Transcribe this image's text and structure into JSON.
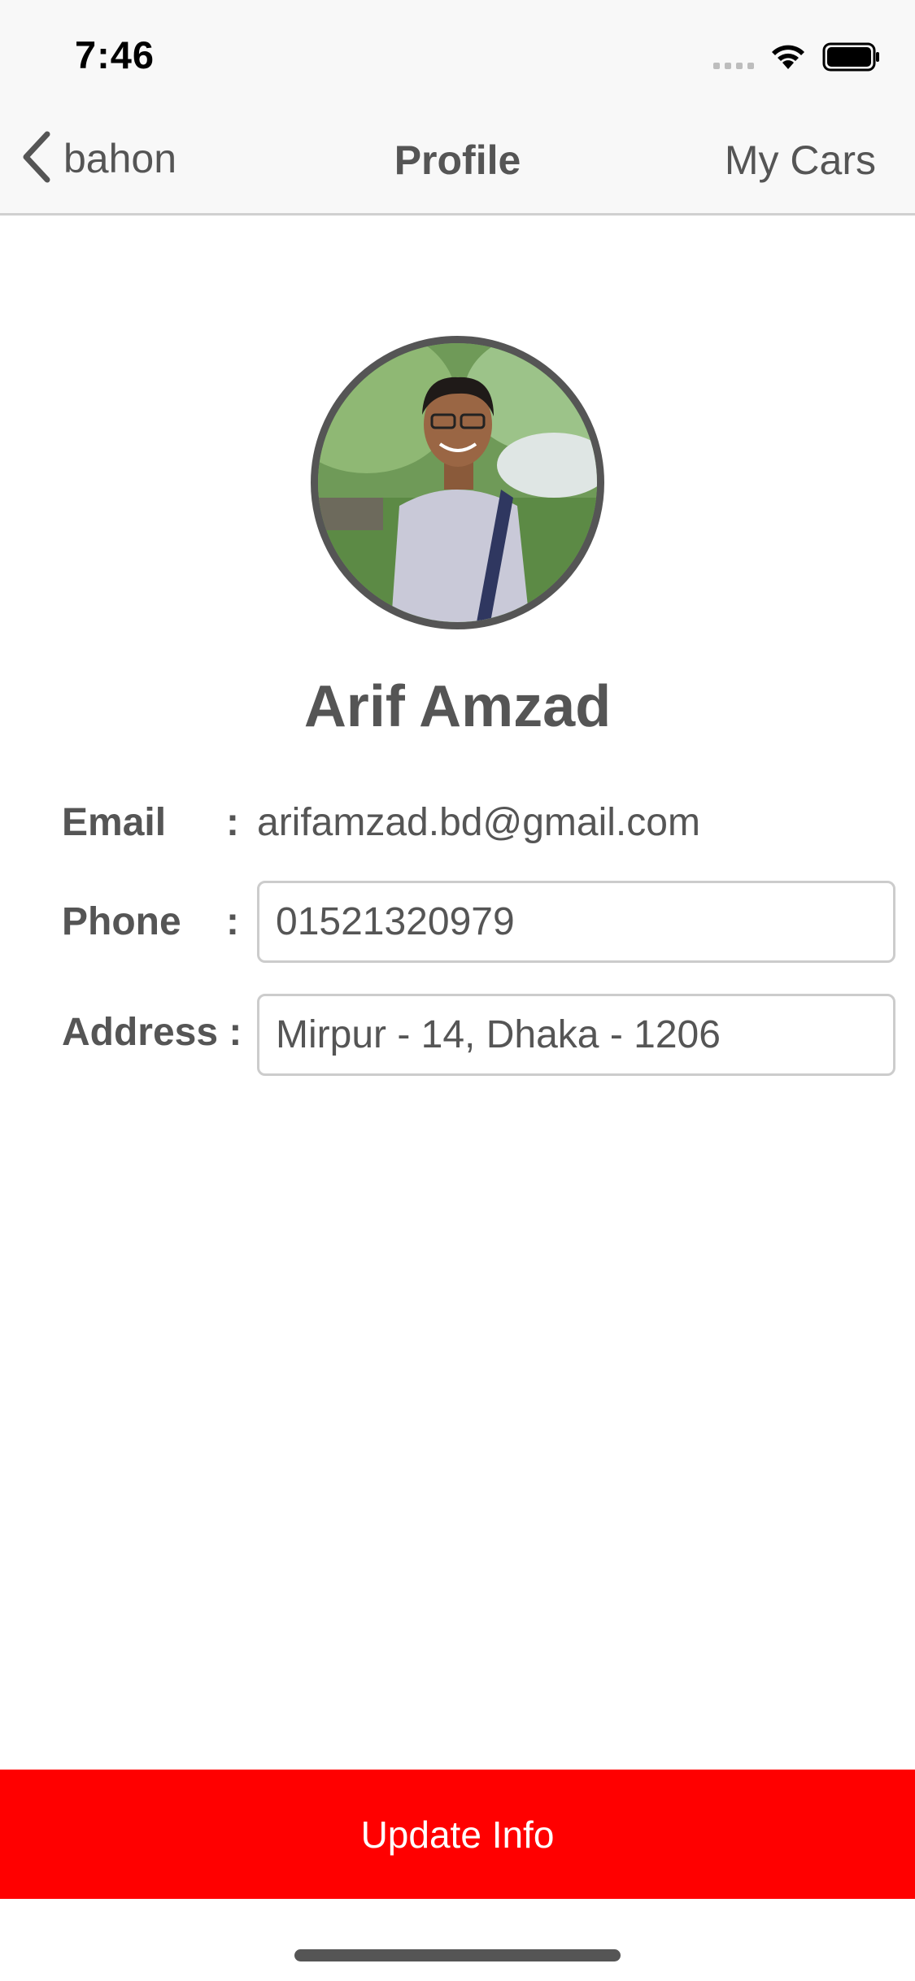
{
  "status_bar": {
    "time": "7:46",
    "signal_icon": "cellular-signal-icon",
    "wifi_icon": "wifi-icon",
    "battery_icon": "battery-icon"
  },
  "nav": {
    "back_icon": "chevron-left-icon",
    "back_label": "bahon",
    "title": "Profile",
    "right_label": "My Cars"
  },
  "profile": {
    "avatar_icon": "profile-photo",
    "name": "Arif Amzad",
    "email_label": "Email",
    "email_value": "arifamzad.bd@gmail.com",
    "phone_label": "Phone",
    "phone_value": "01521320979",
    "address_label": "Address :",
    "address_value": "Mirpur - 14, Dhaka - 1206",
    "colon": ":"
  },
  "actions": {
    "update_label": "Update Info"
  },
  "colors": {
    "accent": "#ff0000",
    "text": "#555555",
    "nav_bg": "#f8f8f8"
  }
}
